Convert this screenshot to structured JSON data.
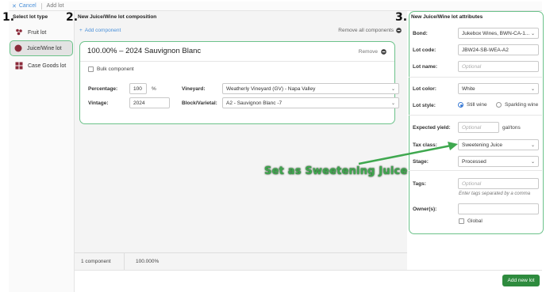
{
  "topbar": {
    "cancel": "Cancel",
    "crumb": "Add lot"
  },
  "steps": {
    "one": "1.",
    "two": "2.",
    "three": "3."
  },
  "lot_types": {
    "title": "Select lot type",
    "items": [
      {
        "label": "Fruit lot",
        "icon": "grapes-icon",
        "color": "#8b2a3a"
      },
      {
        "label": "Juice/Wine lot",
        "icon": "circle-icon",
        "color": "#8b2a3a",
        "selected": true
      },
      {
        "label": "Case Goods lot",
        "icon": "grid-icon",
        "color": "#8b2a3a"
      }
    ]
  },
  "composition": {
    "title": "New Juice/Wine lot composition",
    "add_component": "Add component",
    "remove_all": "Remove all components",
    "card": {
      "title": "100.00%  –  2024 Sauvignon Blanc",
      "remove": "Remove",
      "bulk_label": "Bulk component",
      "percentage_label": "Percentage:",
      "percentage_value": "100",
      "percentage_unit": "%",
      "vintage_label": "Vintage:",
      "vintage_value": "2024",
      "vineyard_label": "Vineyard:",
      "vineyard_value": "Weatherly Vineyard (GV) - Napa Valley",
      "block_label": "Block/Varietal:",
      "block_value": "A2 - Sauvignon Blanc -7"
    },
    "footer": {
      "count": "1 component",
      "percent": "100.000%"
    }
  },
  "attributes": {
    "title": "New Juice/Wine lot attributes",
    "bond_label": "Bond:",
    "bond_value": "Jukebox Wines, BWN-CA-1...",
    "lot_code_label": "Lot code:",
    "lot_code_value": "JBW24-SB-WEA-A2",
    "lot_name_label": "Lot name:",
    "lot_name_placeholder": "Optional",
    "lot_color_label": "Lot color:",
    "lot_color_value": "White",
    "lot_style_label": "Lot style:",
    "style_still": "Still wine",
    "style_sparkling": "Sparkling wine",
    "yield_label": "Expected yield:",
    "yield_placeholder": "Optional",
    "yield_unit": "gal/tons",
    "tax_label": "Tax class:",
    "tax_value": "Sweetening Juice",
    "stage_label": "Stage:",
    "stage_value": "Processed",
    "tags_label": "Tags:",
    "tags_placeholder": "Optional",
    "tags_hint": "Enter tags separated by a comma",
    "owners_label": "Owner(s):",
    "global_label": "Global"
  },
  "actions": {
    "add_new_lot": "Add new lot"
  },
  "annotation": {
    "text": "Set as Sweetening Juice"
  },
  "colors": {
    "accent": "#4a90d9",
    "success": "#2e8b3e",
    "highlight": "#6cc28a"
  }
}
